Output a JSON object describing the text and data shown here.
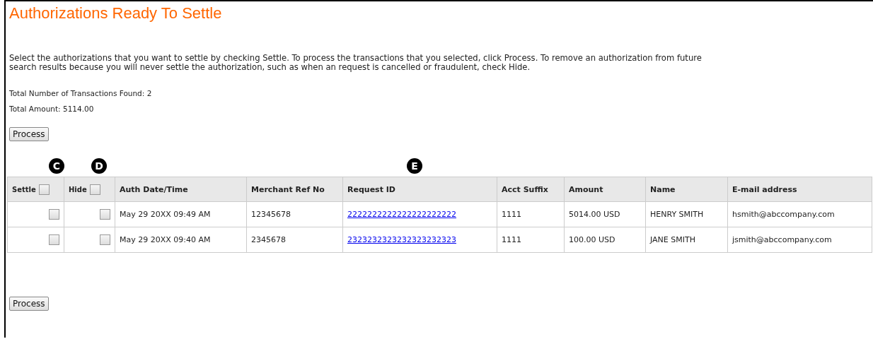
{
  "title": "Authorizations Ready To Settle",
  "instructions": "Select the authorizations that you want to settle by checking Settle. To process the transactions that you selected, click Process. To remove an authorization from future search results because you will never settle the authorization, such as when an request is cancelled or fraudulent, check Hide.",
  "totals": [
    "Total Number of Transactions Found: 2",
    "Total Amount: 5114.00"
  ],
  "process_button": "Process",
  "table": {
    "columns": [
      {
        "label": "Settle",
        "kind": "checkbox",
        "checked": false,
        "callout": "C"
      },
      {
        "label": "Hide",
        "kind": "checkbox",
        "checked": false,
        "callout": "D"
      },
      {
        "label": "Auth Date/Time",
        "kind": "text"
      },
      {
        "label": "Merchant Ref No",
        "kind": "text"
      },
      {
        "label": "Request ID",
        "kind": "link",
        "callout": "E"
      },
      {
        "label": "Acct Suffix",
        "kind": "text"
      },
      {
        "label": "Amount",
        "kind": "text"
      },
      {
        "label": "Name",
        "kind": "text"
      },
      {
        "label": "E-mail address",
        "kind": "text"
      }
    ],
    "rows": [
      {
        "cells": [
          {
            "kind": "checkbox",
            "checked": false
          },
          {
            "kind": "checkbox",
            "checked": false
          },
          "May 29 20XX 09:49 AM",
          "12345678",
          "2222222222222222222222",
          "1111",
          "5014.00 USD",
          "HENRY SMITH",
          "hsmith@abccompany.com"
        ]
      },
      {
        "cells": [
          {
            "kind": "checkbox",
            "checked": false
          },
          {
            "kind": "checkbox",
            "checked": false
          },
          "May 29 20XX 09:40 AM",
          "2345678",
          "2323232323232323232323",
          "1111",
          "100.00 USD",
          "JANE SMITH",
          "jsmith@abccompany.com"
        ]
      }
    ]
  },
  "bottom_button": "Process"
}
